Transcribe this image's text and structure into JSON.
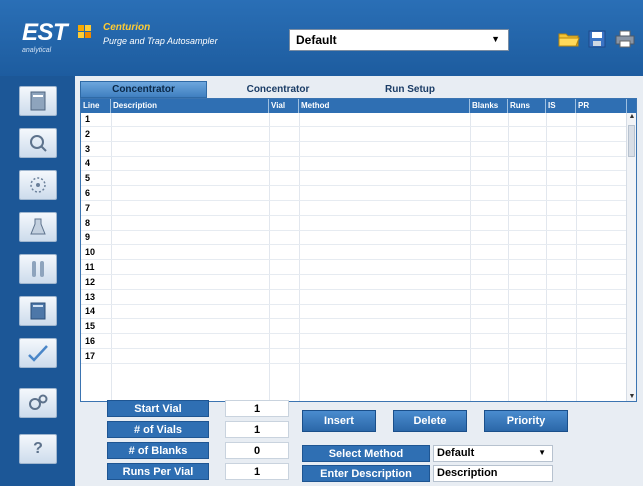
{
  "header": {
    "logo": "EST",
    "logo_sub": "analytical",
    "product_title": "Centurion",
    "product_sub": "Purge and Trap Autosampler",
    "method_value": "Default"
  },
  "tabs": [
    {
      "label": "Concentrator"
    },
    {
      "label": "Concentrator"
    },
    {
      "label": "Run Setup"
    }
  ],
  "grid": {
    "columns": [
      "Line",
      "Description",
      "Vial",
      "Method",
      "Blanks",
      "Runs",
      "IS",
      "PR"
    ],
    "lines": [
      "1",
      "2",
      "3",
      "4",
      "5",
      "6",
      "7",
      "8",
      "9",
      "10",
      "11",
      "12",
      "13",
      "14",
      "15",
      "16",
      "17"
    ]
  },
  "controls": {
    "start_vial_label": "Start Vial",
    "start_vial_value": "1",
    "num_vials_label": "# of Vials",
    "num_vials_value": "1",
    "num_blanks_label": "# of Blanks",
    "num_blanks_value": "0",
    "runs_per_vial_label": "Runs Per Vial",
    "runs_per_vial_value": "1",
    "insert_label": "Insert",
    "delete_label": "Delete",
    "priority_label": "Priority",
    "select_method_label": "Select Method",
    "select_method_value": "Default",
    "enter_description_label": "Enter Description",
    "description_value": "Description"
  },
  "colors": {
    "brand_blue": "#1f5b9c",
    "header_blue": "#2f6fb3",
    "accent_yellow": "#ffcc33"
  }
}
